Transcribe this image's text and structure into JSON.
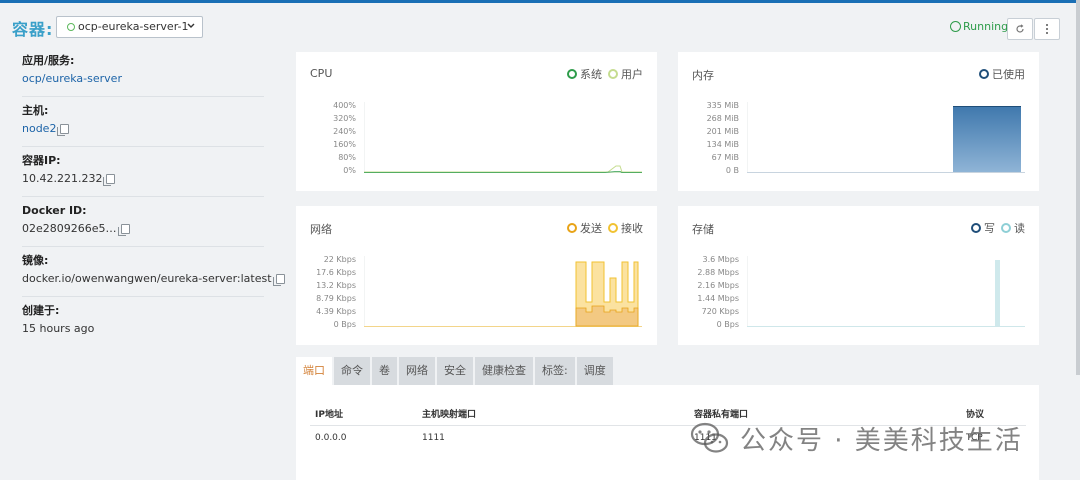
{
  "header": {
    "title": "容器:",
    "container_select": "ocp-eureka-server-1",
    "status": "Running"
  },
  "sidebar": {
    "items": [
      {
        "label": "应用/服务:",
        "value": "ocp/eureka-server"
      },
      {
        "label": "主机:",
        "value": "node2"
      },
      {
        "label": "容器IP:",
        "value": "10.42.221.232"
      },
      {
        "label": "Docker ID:",
        "value": "02e2809266e5…"
      },
      {
        "label": "镜像:",
        "value": "docker.io/owenwangwen/eureka-server:latest"
      },
      {
        "label": "创建于:",
        "value": "15 hours ago"
      }
    ]
  },
  "panels": {
    "cpu": {
      "title": "CPU",
      "legend": [
        "系统",
        "用户"
      ],
      "ticks": [
        "400%",
        "320%",
        "240%",
        "160%",
        "80%",
        "0%"
      ]
    },
    "memory": {
      "title": "内存",
      "legend": [
        "已使用"
      ],
      "ticks": [
        "335 MiB",
        "268 MiB",
        "201 MiB",
        "134 MiB",
        "67 MiB",
        "0 B"
      ]
    },
    "network": {
      "title": "网络",
      "legend": [
        "发送",
        "接收"
      ],
      "ticks": [
        "22 Kbps",
        "17.6 Kbps",
        "13.2 Kbps",
        "8.79 Kbps",
        "4.39 Kbps",
        "0 Bps"
      ]
    },
    "storage": {
      "title": "存储",
      "legend": [
        "写",
        "读"
      ],
      "ticks": [
        "3.6 Mbps",
        "2.88 Mbps",
        "2.16 Mbps",
        "1.44 Mbps",
        "720 Kbps",
        "0 Bps"
      ]
    }
  },
  "tabs": [
    "端口",
    "命令",
    "卷",
    "网络",
    "安全",
    "健康检查",
    "标签:",
    "调度"
  ],
  "ports_table": {
    "headers": [
      "IP地址",
      "主机映射端口",
      "容器私有端口",
      "协议"
    ],
    "rows": [
      [
        "0.0.0.0",
        "1111",
        "1111",
        "TCP"
      ]
    ]
  },
  "colors": {
    "accent": "#3aa0c9",
    "running": "#2e9c4a",
    "cpu_system": "#2e9c4a",
    "cpu_user": "#c5dc8f",
    "memory_used": "#1f4e79",
    "network_send": "#e8a317",
    "network_recv": "#f1c232",
    "storage_write": "#1f4e79",
    "storage_read": "#8ecfd6",
    "active_tab": "#d4833a"
  },
  "watermark": "公众号 · 美美科技生活"
}
